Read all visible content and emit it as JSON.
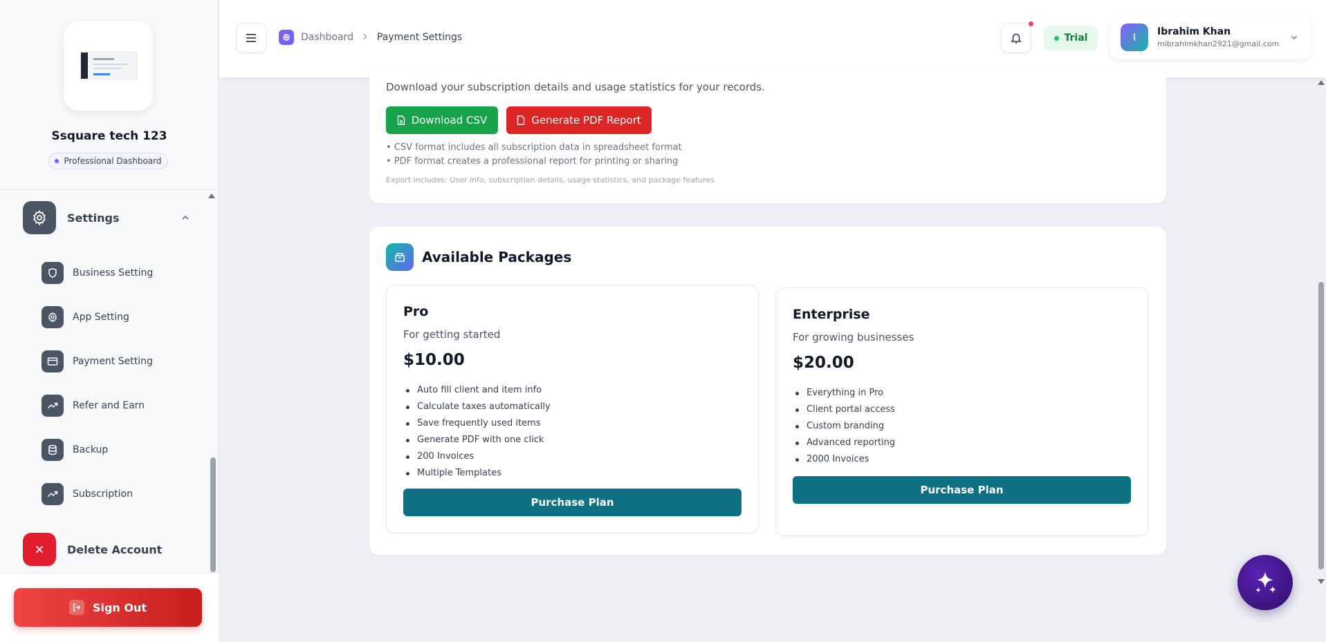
{
  "brand": {
    "name": "Ssquare tech 123",
    "badge": "Professional Dashboard"
  },
  "sidebar": {
    "settings_label": "Settings",
    "items": [
      {
        "label": "Business Setting",
        "icon": "shield-icon"
      },
      {
        "label": "App Setting",
        "icon": "gear-icon"
      },
      {
        "label": "Payment Setting",
        "icon": "card-icon"
      },
      {
        "label": "Refer and Earn",
        "icon": "trend-icon"
      },
      {
        "label": "Backup",
        "icon": "database-icon"
      },
      {
        "label": "Subscription",
        "icon": "trend-icon"
      }
    ],
    "delete_label": "Delete Account",
    "signout_label": "Sign Out"
  },
  "header": {
    "breadcrumb": {
      "home": "Dashboard",
      "current": "Payment Settings"
    },
    "trial_label": "Trial",
    "user": {
      "initial": "I",
      "name": "Ibrahim Khan",
      "email": "mibrahimkhan2921@gmail.com"
    }
  },
  "export": {
    "description": "Download your subscription details and usage statistics for your records.",
    "csv_label": "Download CSV",
    "pdf_label": "Generate PDF Report",
    "notes": [
      "• CSV format includes all subscription data in spreadsheet format",
      "• PDF format creates a professional report for printing or sharing"
    ],
    "footer": "Export includes: User info, subscription details, usage statistics, and package features"
  },
  "packages": {
    "title": "Available Packages",
    "plans": [
      {
        "name": "Pro",
        "subtitle": "For getting started",
        "price": "$10.00",
        "features": [
          "Auto fill client and item info",
          "Calculate taxes automatically",
          "Save frequently used items",
          "Generate PDF with one click",
          "200 Invoices",
          "Multiple Templates"
        ],
        "button": "Purchase Plan"
      },
      {
        "name": "Enterprise",
        "subtitle": "For growing businesses",
        "price": "$20.00",
        "features": [
          "Everything in Pro",
          "Client portal access",
          "Custom branding",
          "Advanced reporting",
          "2000 Invoices"
        ],
        "button": "Purchase Plan"
      }
    ]
  },
  "colors": {
    "accent_teal": "#0e7083",
    "csv_green": "#16a34a",
    "pdf_red": "#dc2626",
    "danger": "#e11d2e",
    "trial_green": "#15803d"
  }
}
